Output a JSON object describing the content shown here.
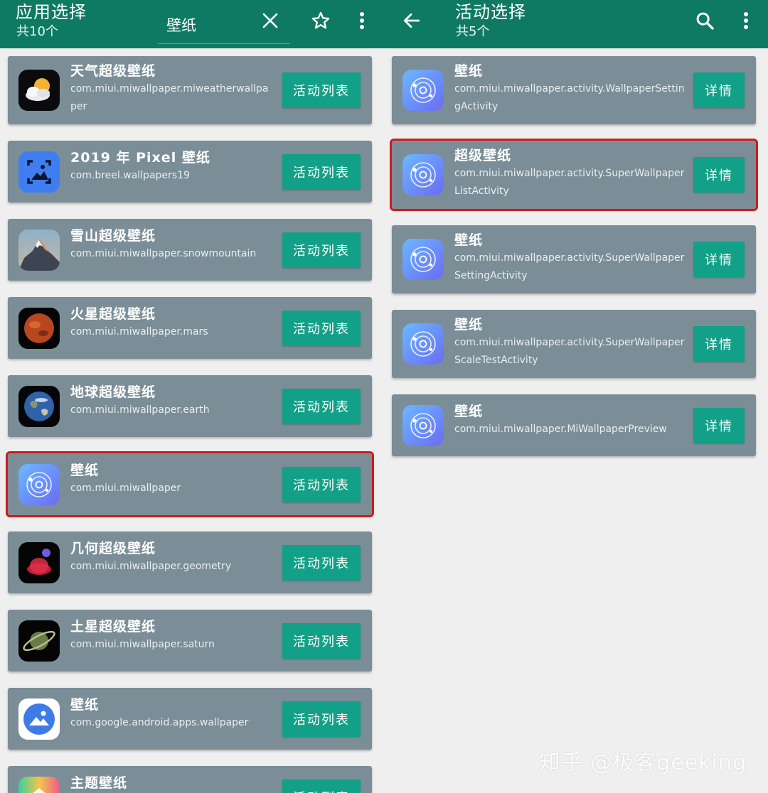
{
  "left": {
    "appbar": {
      "title": "应用选择",
      "subtitle": "共10个",
      "search_value": "壁纸"
    },
    "action_label": "活动列表",
    "apps": [
      {
        "name": "天气超级壁纸",
        "package": "com.miui.miwallpaper.miweatherwallpaper",
        "icon": "weather-sun-cloud-icon"
      },
      {
        "name": "2019 年 Pixel 壁纸",
        "package": "com.breel.wallpapers19",
        "icon": "pixel-wallpaper-icon"
      },
      {
        "name": "雪山超级壁纸",
        "package": "com.miui.miwallpaper.snowmountain",
        "icon": "snow-mountain-icon"
      },
      {
        "name": "火星超级壁纸",
        "package": "com.miui.miwallpaper.mars",
        "icon": "mars-planet-icon"
      },
      {
        "name": "地球超级壁纸",
        "package": "com.miui.miwallpaper.earth",
        "icon": "earth-planet-icon"
      },
      {
        "name": "壁纸",
        "package": "com.miui.miwallpaper",
        "icon": "miui-wallpaper-icon",
        "highlighted": true
      },
      {
        "name": "几何超级壁纸",
        "package": "com.miui.miwallpaper.geometry",
        "icon": "geometry-icon"
      },
      {
        "name": "土星超级壁纸",
        "package": "com.miui.miwallpaper.saturn",
        "icon": "saturn-planet-icon"
      },
      {
        "name": "壁纸",
        "package": "com.google.android.apps.wallpaper",
        "icon": "google-wallpaper-icon"
      },
      {
        "name": "主题壁纸",
        "package": "",
        "icon": "theme-wallpaper-icon"
      }
    ]
  },
  "right": {
    "appbar": {
      "title": "活动选择",
      "subtitle": "共5个"
    },
    "detail_label": "详情",
    "activities": [
      {
        "name": "壁纸",
        "activity": "com.miui.miwallpaper.activity.WallpaperSettingActivity",
        "icon": "miui-wallpaper-icon"
      },
      {
        "name": "超级壁纸",
        "activity": "com.miui.miwallpaper.activity.SuperWallpaperListActivity",
        "icon": "miui-wallpaper-icon",
        "highlighted": true
      },
      {
        "name": "壁纸",
        "activity": "com.miui.miwallpaper.activity.SuperWallpaperSettingActivity",
        "icon": "miui-wallpaper-icon"
      },
      {
        "name": "壁纸",
        "activity": "com.miui.miwallpaper.activity.SuperWallpaperScaleTestActivity",
        "icon": "miui-wallpaper-icon"
      },
      {
        "name": "壁纸",
        "activity": "com.miui.miwallpaper.MiWallpaperPreview",
        "icon": "miui-wallpaper-icon"
      }
    ]
  },
  "watermark": "知乎 @极客geeking",
  "colors": {
    "appbar": "#0f7a64",
    "card": "#7b8e97",
    "button": "#13a088",
    "highlight": "#d11a1a",
    "background": "#efefef"
  }
}
